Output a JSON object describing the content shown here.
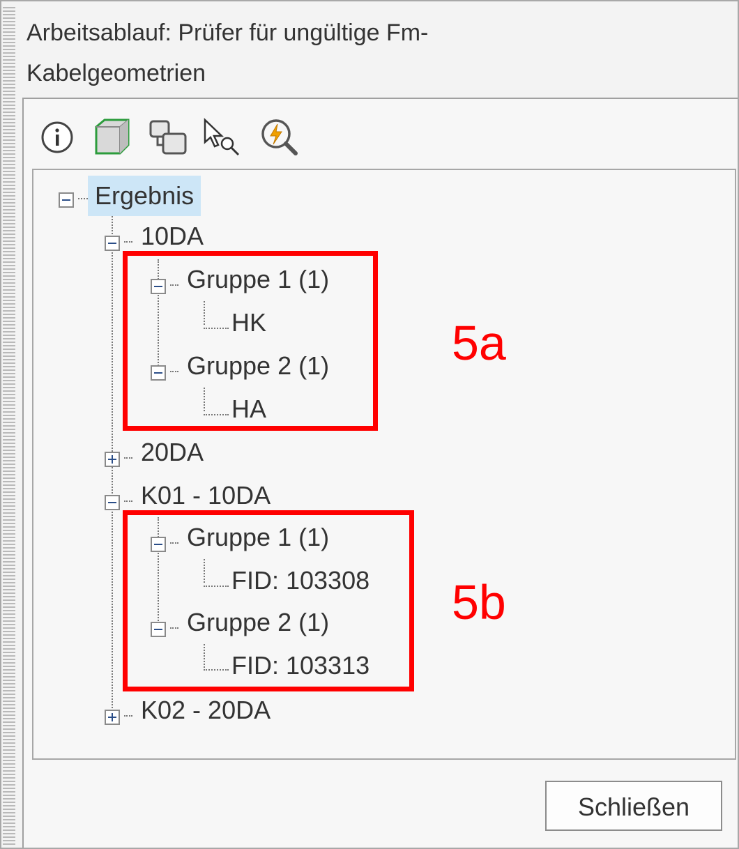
{
  "window": {
    "title": "Arbeitsablauf: Prüfer für ungültige Fm-Kabelgeometrien"
  },
  "toolbar": {
    "icons": [
      "info-icon",
      "cube-icon",
      "copy-icon",
      "select-zoom-icon",
      "zoom-flash-icon"
    ]
  },
  "tree": {
    "root": "Ergebnis",
    "n10da": "10DA",
    "n10da_g1": "Gruppe 1 (1)",
    "n10da_g1_c": "HK",
    "n10da_g2": "Gruppe 2 (1)",
    "n10da_g2_c": "HA",
    "n20da": "20DA",
    "k01": "K01 - 10DA",
    "k01_g1": "Gruppe 1 (1)",
    "k01_g1_c": "FID: 103308",
    "k01_g2": "Gruppe 2 (1)",
    "k01_g2_c": "FID: 103313",
    "k02": "K02 - 20DA"
  },
  "annotations": {
    "a": "5a",
    "b": "5b",
    "color": "#ff0000"
  },
  "buttons": {
    "close": "Schließen"
  }
}
